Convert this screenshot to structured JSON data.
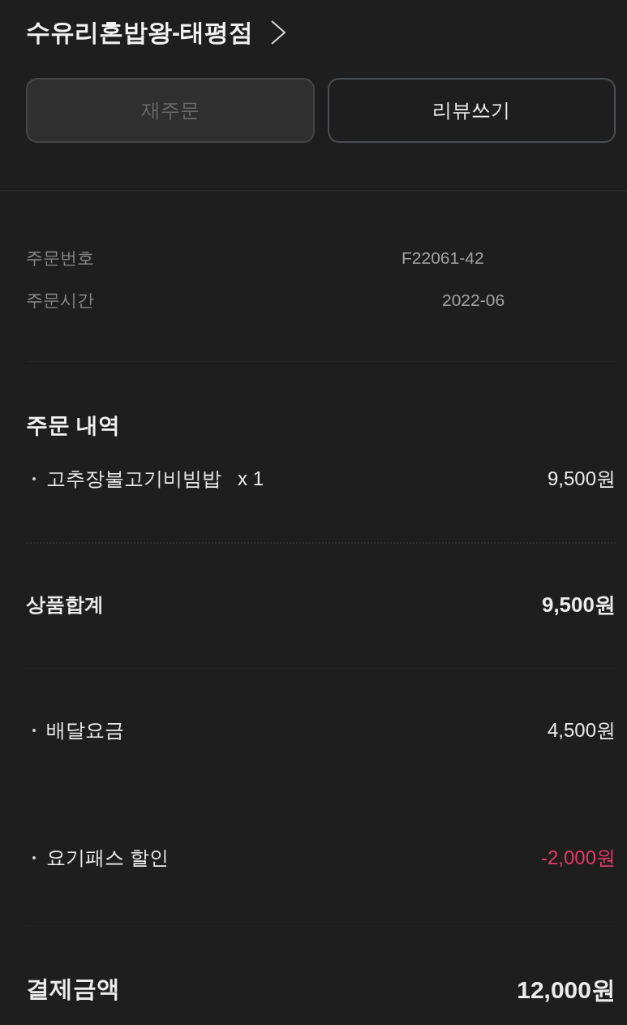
{
  "store": {
    "name": "수유리혼밥왕-태평점"
  },
  "actions": [
    {
      "label": "재주문",
      "disabled": true
    },
    {
      "label": "리뷰쓰기",
      "disabled": false
    }
  ],
  "order_info": [
    {
      "label": "주문번호",
      "value": "F22061-42"
    },
    {
      "label": "주문시간",
      "value": "2022-06"
    }
  ],
  "order_details": {
    "title": "주문 내역",
    "items": [
      {
        "name": "고추장불고기비빔밥",
        "quantity": "x 1",
        "price": "9,500원"
      }
    ]
  },
  "subtotal": {
    "label": "상품합계",
    "amount": "9,500원"
  },
  "charges": [
    {
      "kind": "fee",
      "label": "배달요금",
      "amount": "4,500원"
    },
    {
      "kind": "discount",
      "label": "요기패스 할인",
      "amount": "-2,000원"
    }
  ],
  "total": {
    "label": "결제금액",
    "amount": "12,000원"
  }
}
